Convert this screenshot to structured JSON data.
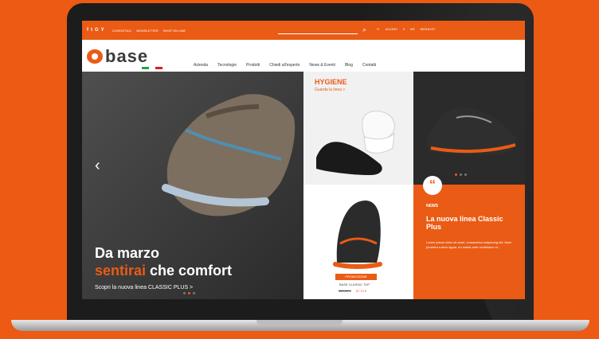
{
  "topbar": {
    "social": [
      "f",
      "t",
      "G",
      "Y"
    ],
    "links": [
      "CONTATTACI",
      "NEWSLETTER",
      "SHOP ON LINE"
    ],
    "search_placeholder": "",
    "right": [
      "IT",
      "ACCEDI",
      "0",
      "0/€",
      "WISHLIST"
    ]
  },
  "header": {
    "logo_text": "base",
    "flag_colors": [
      "#1aa34a",
      "#ffffff",
      "#d61f26"
    ],
    "nav": [
      "Azienda",
      "Tecnologie",
      "Prodotti",
      "Chiedi all'esperto",
      "News & Eventi",
      "Blog",
      "Contatti"
    ]
  },
  "hero": {
    "title_line1": "Da marzo",
    "title_line2_orange": "sentirai",
    "title_line2_rest": " che comfort",
    "link": "Scopri la nuova linea CLASSIC PLUS >"
  },
  "hygiene": {
    "title": "HYGIENE",
    "link": "Guarda la linea >"
  },
  "promo": {
    "badge": "PROMOZIONE",
    "code": "BASE CLASSIC TOP",
    "old_price": "140,00 €",
    "new_price": "67,13 €"
  },
  "news": {
    "quote": "“",
    "label": "NEWS",
    "title": "La nuova linea Classic Plus",
    "body": "Lorem ipsum dolor sit amet, consectetur adipiscing elit. Nam pharetra rutrum ligula, eu mattis ante vestibulum in..."
  }
}
